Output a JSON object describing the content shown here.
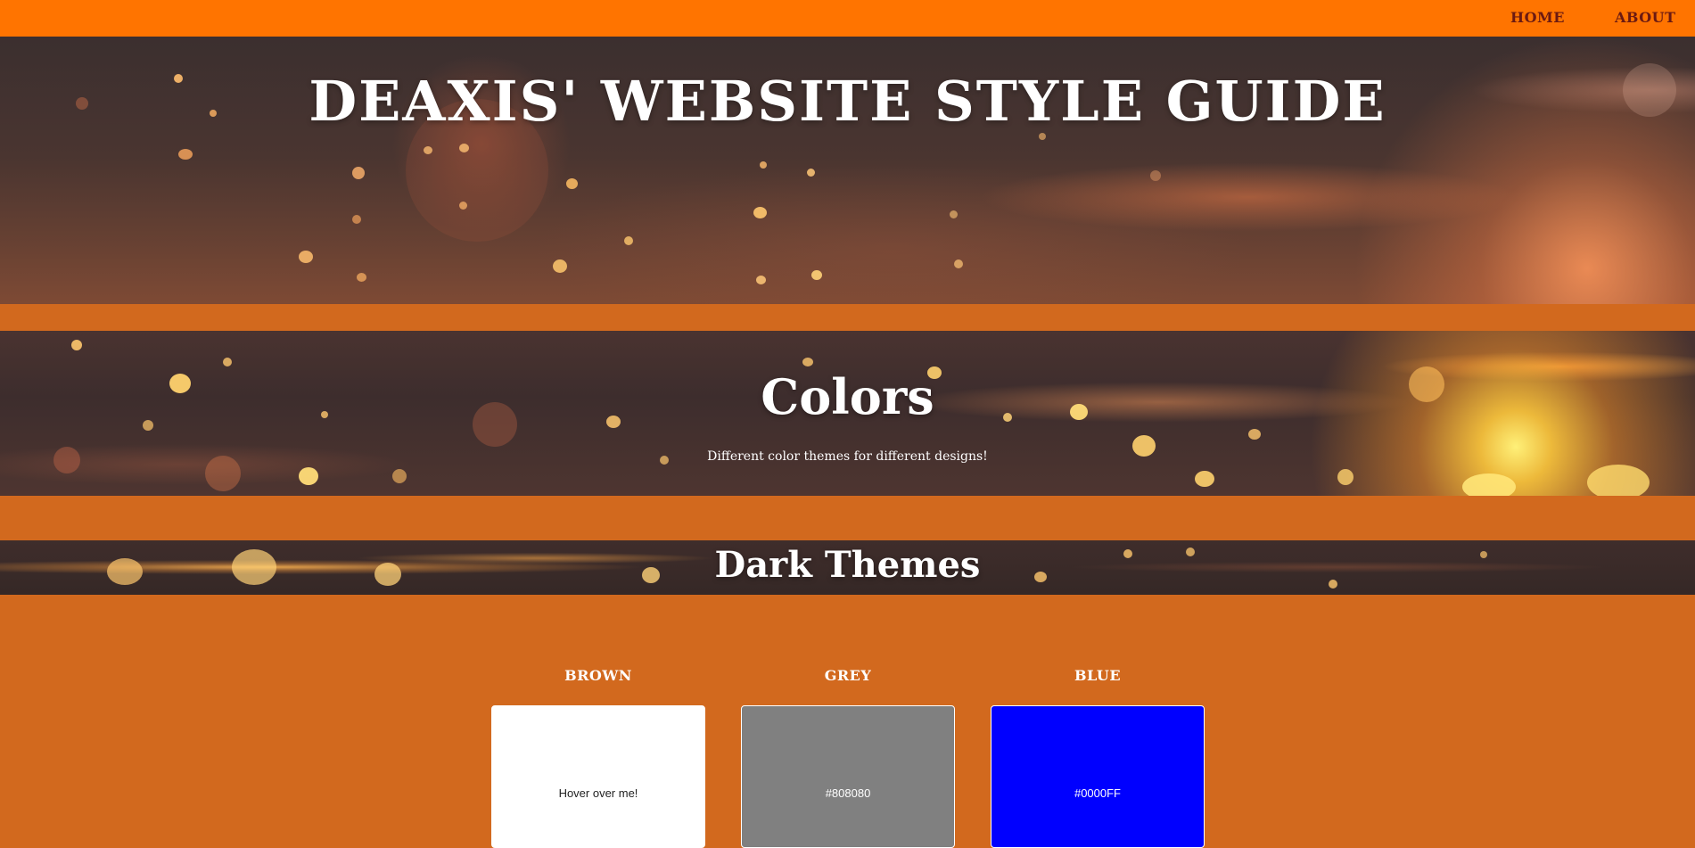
{
  "nav": {
    "home_label": "HOME",
    "about_label": "ABOUT"
  },
  "hero": {
    "title": "DEAXIS' WEBSITE STYLE GUIDE"
  },
  "colors_section": {
    "title": "Colors",
    "subtitle": "Different color themes for different designs!"
  },
  "dark_themes": {
    "title": "Dark Themes"
  },
  "swatches": [
    {
      "label": "BROWN",
      "text": "Hover over me!",
      "fill": "#FFFFFF",
      "text_color": "#222222"
    },
    {
      "label": "GREY",
      "text": "#808080",
      "fill": "#808080",
      "text_color": "#FFFFFF"
    },
    {
      "label": "BLUE",
      "text": "#0000FF",
      "fill": "#0000FF",
      "text_color": "#FFFFFF"
    }
  ],
  "colors": {
    "nav_bar": "#FF7400",
    "nav_text": "#6B1A12",
    "page_background": "#D2691E"
  }
}
